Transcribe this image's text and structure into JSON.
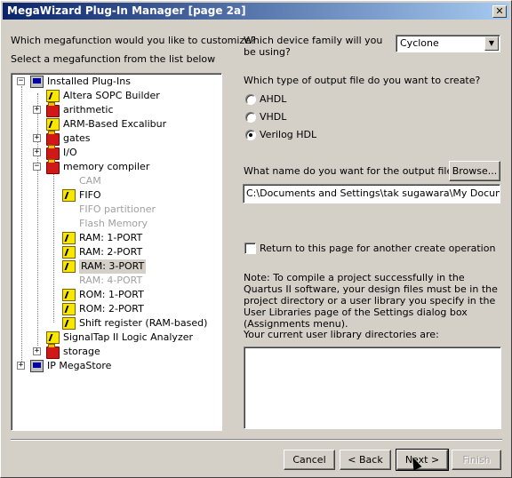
{
  "window": {
    "title": "MegaWizard Plug-In Manager [page 2a]",
    "close_glyph": "✕"
  },
  "left": {
    "q1": "Which megafunction would you like to customize?",
    "q2": "Select a megafunction from the list below"
  },
  "tree": {
    "installed": "Installed Plug-Ins",
    "sopc": "Altera SOPC Builder",
    "arithmetic": "arithmetic",
    "arm": "ARM-Based Excalibur",
    "gates": "gates",
    "io": "I/O",
    "memory": "memory compiler",
    "cam": "CAM",
    "fifo": "FIFO",
    "fifo_part": "FIFO partitioner",
    "flash": "Flash Memory",
    "ram1": "RAM: 1-PORT",
    "ram2": "RAM: 2-PORT",
    "ram3": "RAM: 3-PORT",
    "ram4": "RAM: 4-PORT",
    "rom1": "ROM: 1-PORT",
    "rom2": "ROM: 2-PORT",
    "shift": "Shift register (RAM-based)",
    "signaltap": "SignalTap II Logic Analyzer",
    "storage": "storage",
    "ipmega": "IP MegaStore",
    "plus": "+",
    "minus": "−"
  },
  "right": {
    "device_q": "Which device family will you be using?",
    "device_value": "Cyclone",
    "device_arrow": "▼",
    "output_q": "Which type of output file do you want to create?",
    "ahdl": "AHDL",
    "vhdl": "VHDL",
    "verilog": "Verilog HDL",
    "name_q": "What name do you want for the output file?",
    "browse": "Browse...",
    "output_path": "C:\\Documents and Settings\\tak sugawara\\My Documents\\",
    "return_label": "Return to this page for another create operation",
    "note": "Note: To compile a project successfully in the Quartus II software, your design files must be in the project directory or a user library you specify in the User Libraries page of the Settings dialog box (Assignments menu).",
    "libdirs_label": "Your current user library directories are:"
  },
  "footer": {
    "cancel": "Cancel",
    "back": "< Back",
    "next": "Next >",
    "finish": "Finish"
  }
}
